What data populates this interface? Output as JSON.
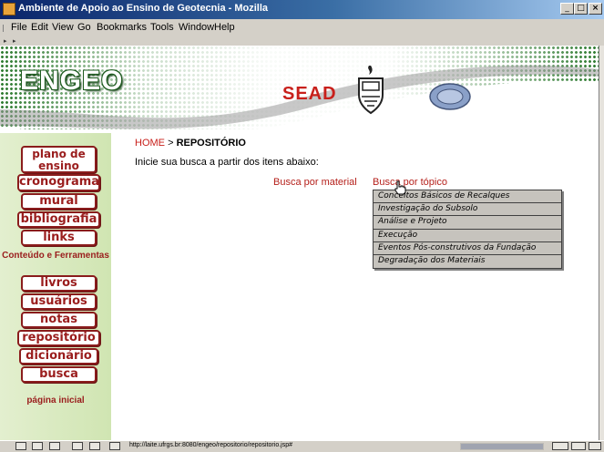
{
  "window": {
    "title": "Ambiente de Apoio ao Ensino de Geotecnia - Mozilla",
    "minimize_glyph": "_",
    "maximize_glyph": "□",
    "close_glyph": "×"
  },
  "menubar": {
    "items": [
      {
        "label": "File"
      },
      {
        "label": "Edit"
      },
      {
        "label": "View"
      },
      {
        "label": "Go"
      },
      {
        "label": "Bookmarks"
      },
      {
        "label": "Tools"
      },
      {
        "label": "Window"
      },
      {
        "label": "Help"
      }
    ]
  },
  "header": {
    "logo_text": "ENGEO",
    "sead_text": "SEAD",
    "crest_icon": "university-crest-icon",
    "ead_icon": "ead-logo-icon"
  },
  "sidebar": {
    "buttons": [
      {
        "label": "plano de ensino"
      },
      {
        "label": "cronograma"
      },
      {
        "label": "mural"
      },
      {
        "label": "bibliografia"
      },
      {
        "label": "links"
      },
      {
        "label": "livros"
      },
      {
        "label": "usuários"
      },
      {
        "label": "notas"
      },
      {
        "label": "repositório"
      },
      {
        "label": "dicionário"
      },
      {
        "label": "busca"
      }
    ],
    "section_label": "Conteúdo e Ferramentas",
    "home_link": "página inicial"
  },
  "main": {
    "breadcrumb": {
      "home": "HOME",
      "separator": ">",
      "current": "REPOSITÓRIO"
    },
    "intro": "Inicie sua busca a partir dos itens abaixo:",
    "search_by_material": "Busca por material",
    "search_by_topic": "Busca por tópico",
    "topic_menu": [
      "Conceitos Básicos de Recalques",
      "Investigação do Subsolo",
      "Análise e Projeto",
      "Execução",
      "Eventos Pós-construtivos da Fundação",
      "Degradação dos Materiais"
    ]
  },
  "statusbar": {
    "url": "http://laite.ufrgs.br:8080/engeo/repositorio/repositorio.jsp#"
  },
  "colors": {
    "accent_red": "#b5201b",
    "sidebar_green": "#d0e5b2",
    "logo_green": "#1e5b1f"
  }
}
